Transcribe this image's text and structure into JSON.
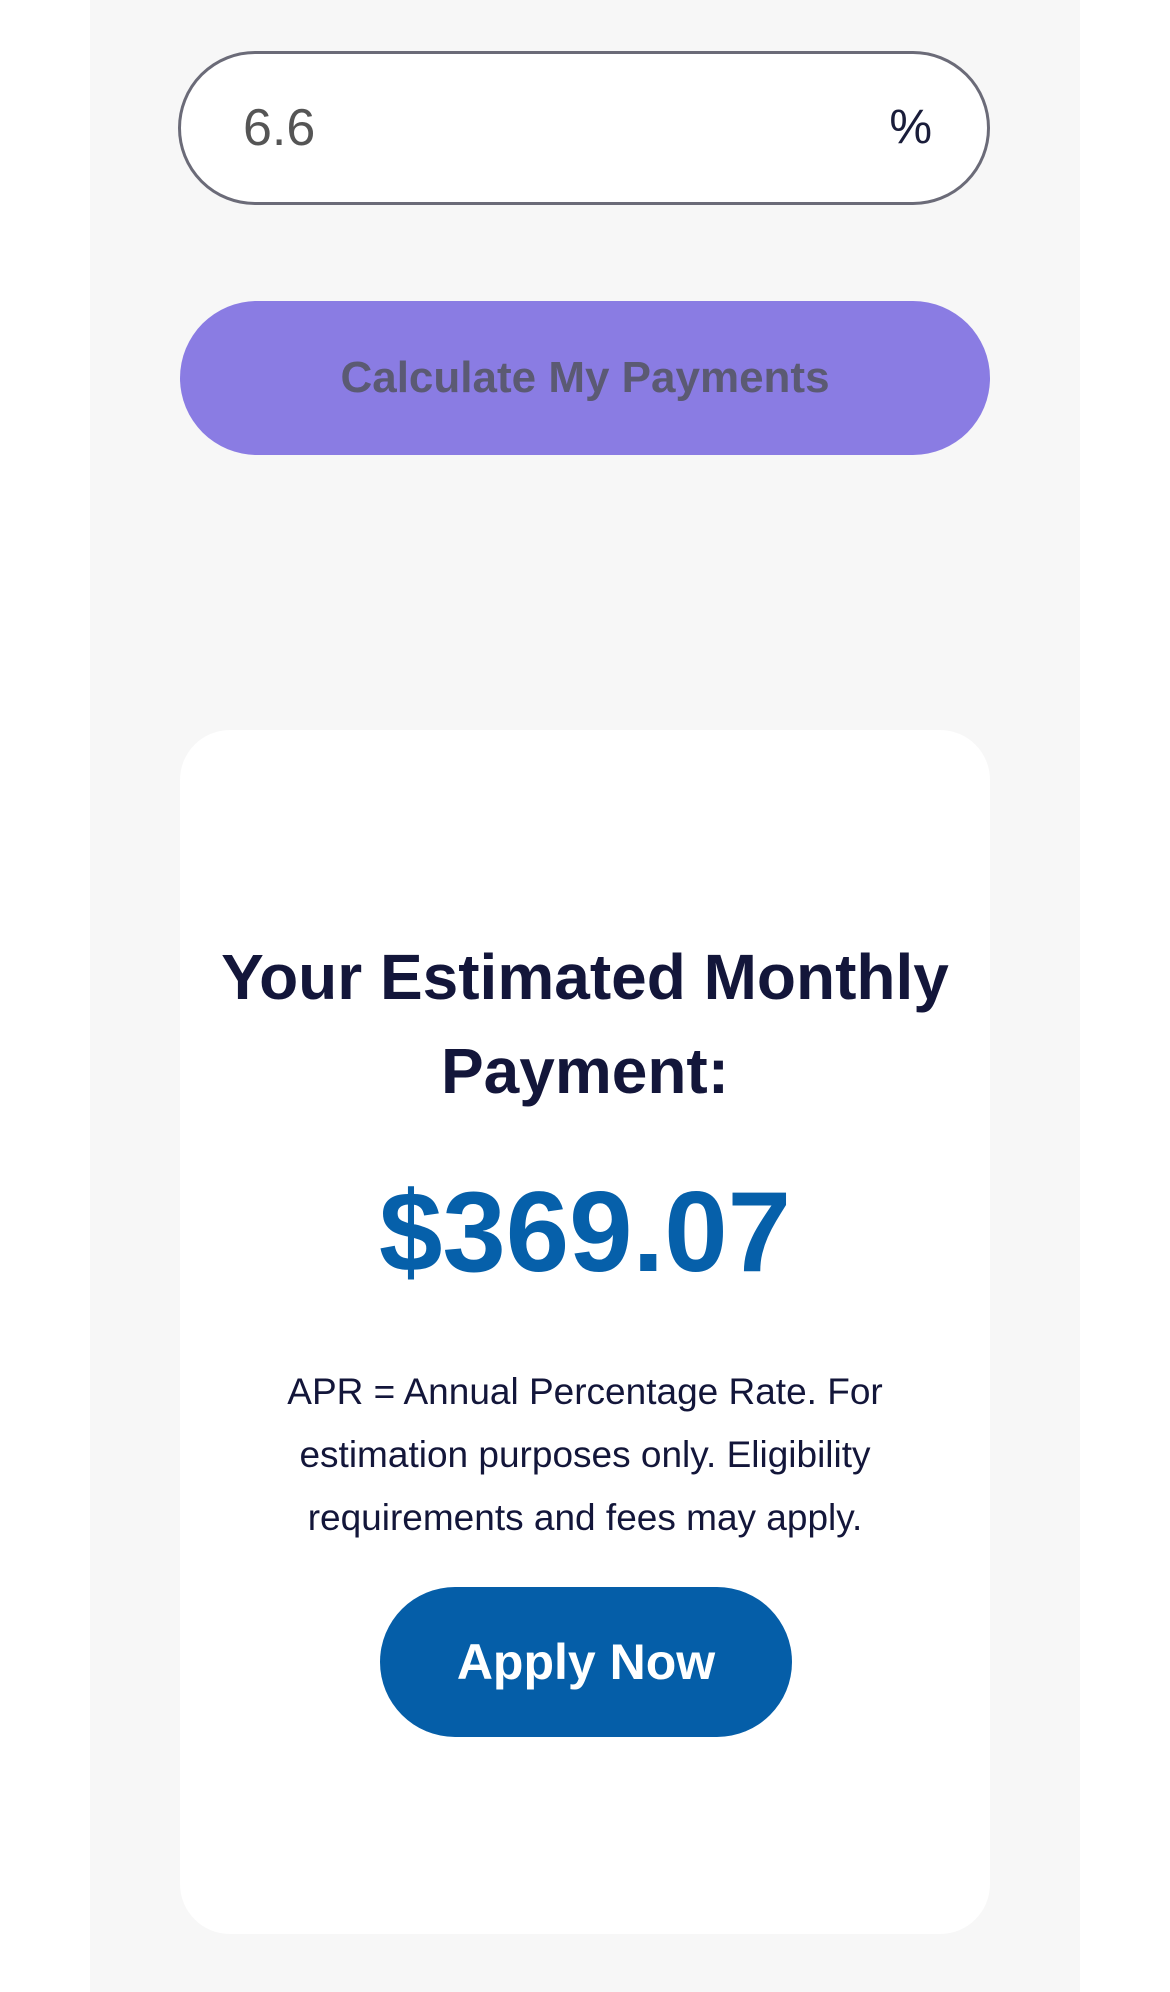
{
  "rate_input": {
    "value": "6.6",
    "unit": "%"
  },
  "calculate_button": {
    "label": "Calculate My Payments"
  },
  "result": {
    "title": "Your Estimated Monthly Payment:",
    "amount": "$369.07",
    "disclaimer": "APR = Annual Percentage Rate. For estimation purposes only. Eligibility requirements and fees may apply.",
    "apply_label": "Apply Now"
  },
  "colors": {
    "calculate_button_bg": "#8a7ce3",
    "amount_text": "#0660aa",
    "apply_button_bg": "#055ea8",
    "page_background": "#f7f7f7"
  }
}
